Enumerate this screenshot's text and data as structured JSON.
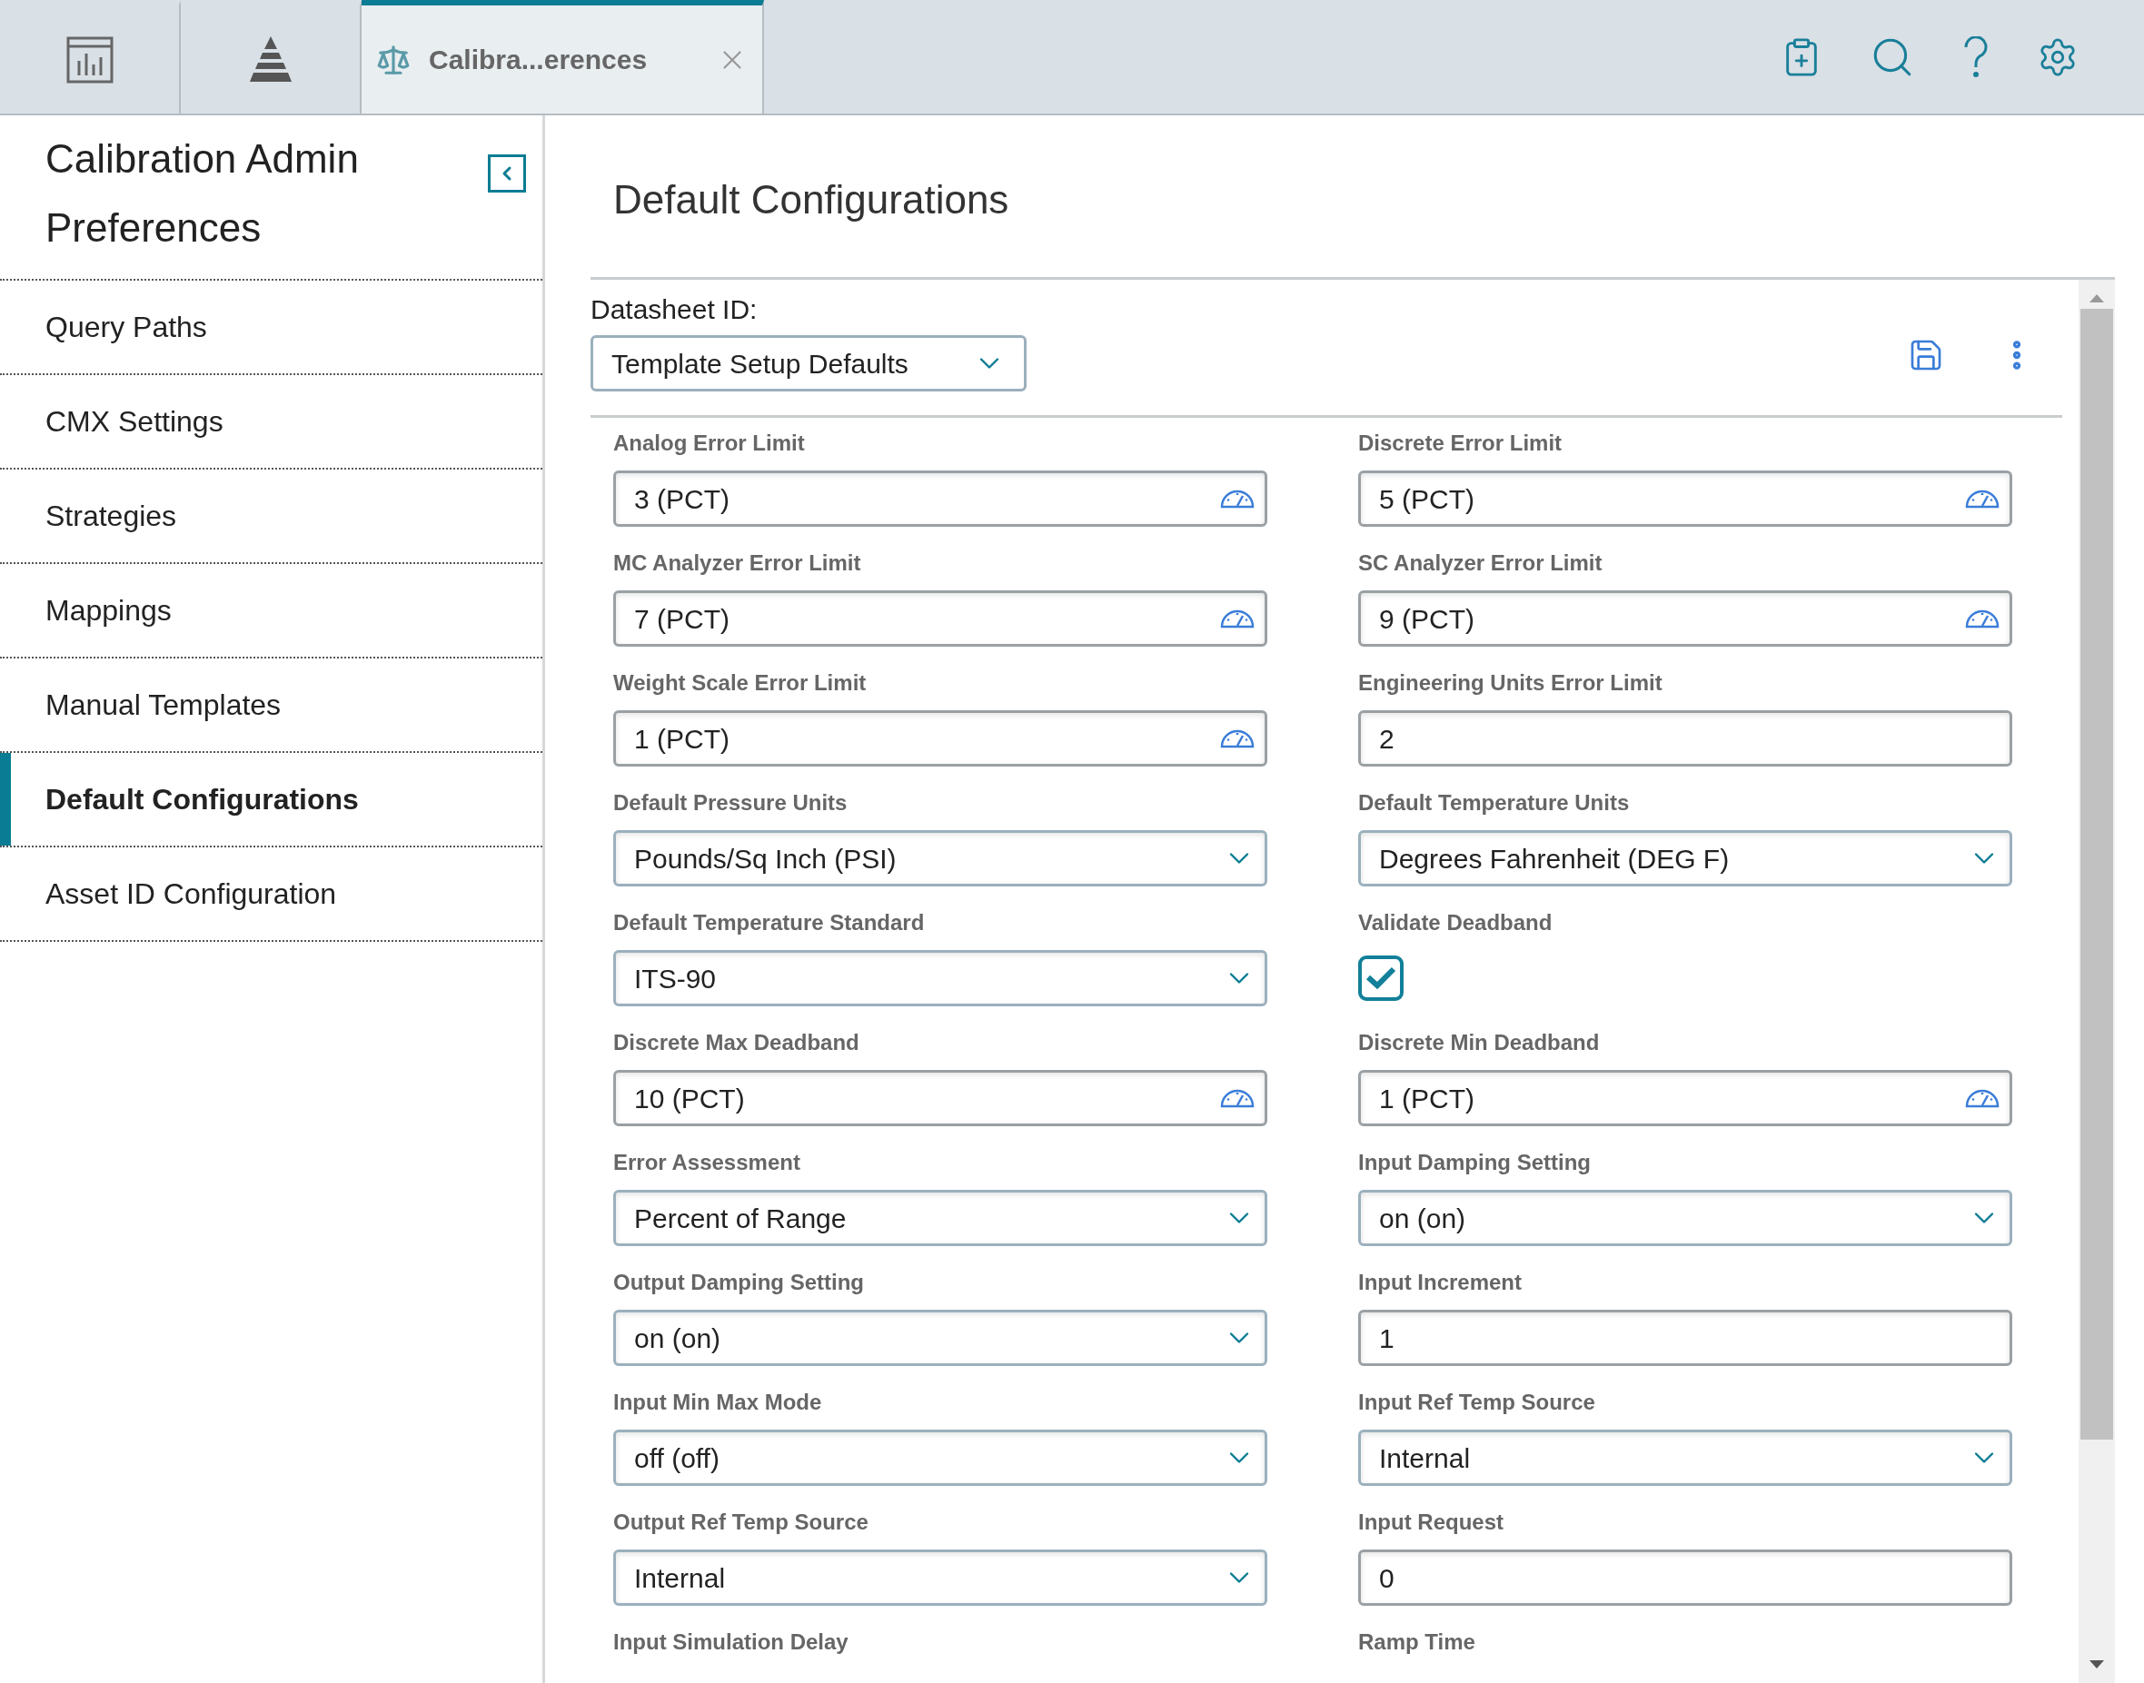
{
  "tabs": [
    {
      "kind": "chart",
      "selected": false
    },
    {
      "kind": "pyramid",
      "selected": false
    },
    {
      "kind": "document",
      "label": "Calibra...erences",
      "selected": true
    }
  ],
  "sidebar": {
    "title": "Calibration Admin Preferences",
    "items": [
      {
        "label": "Query Paths",
        "selected": false
      },
      {
        "label": "CMX Settings",
        "selected": false
      },
      {
        "label": "Strategies",
        "selected": false
      },
      {
        "label": "Mappings",
        "selected": false
      },
      {
        "label": "Manual Templates",
        "selected": false
      },
      {
        "label": "Default Configurations",
        "selected": true
      },
      {
        "label": "Asset ID Configuration",
        "selected": false
      }
    ]
  },
  "main": {
    "title": "Default Configurations",
    "datasheet": {
      "label": "Datasheet ID:",
      "value": "Template Setup Defaults"
    },
    "fields": [
      {
        "kind": "unit",
        "label": "Analog Error Limit",
        "value": "3 (PCT)"
      },
      {
        "kind": "unit",
        "label": "Discrete Error Limit",
        "value": "5 (PCT)"
      },
      {
        "kind": "unit",
        "label": "MC Analyzer Error Limit",
        "value": "7 (PCT)"
      },
      {
        "kind": "unit",
        "label": "SC Analyzer Error Limit",
        "value": "9 (PCT)"
      },
      {
        "kind": "unit",
        "label": "Weight Scale Error Limit",
        "value": "1 (PCT)"
      },
      {
        "kind": "text",
        "label": "Engineering Units Error Limit",
        "value": "2"
      },
      {
        "kind": "select",
        "label": "Default Pressure Units",
        "value": "Pounds/Sq Inch (PSI)"
      },
      {
        "kind": "select",
        "label": "Default Temperature Units",
        "value": "Degrees Fahrenheit (DEG F)"
      },
      {
        "kind": "select",
        "label": "Default Temperature Standard",
        "value": "ITS-90"
      },
      {
        "kind": "checkbox",
        "label": "Validate Deadband",
        "checked": true
      },
      {
        "kind": "unit",
        "label": "Discrete Max Deadband",
        "value": "10 (PCT)"
      },
      {
        "kind": "unit",
        "label": "Discrete Min Deadband",
        "value": "1 (PCT)"
      },
      {
        "kind": "select",
        "label": "Error Assessment",
        "value": "Percent of Range"
      },
      {
        "kind": "select",
        "label": "Input Damping Setting",
        "value": "on (on)"
      },
      {
        "kind": "select",
        "label": "Output Damping Setting",
        "value": "on (on)"
      },
      {
        "kind": "text",
        "label": "Input Increment",
        "value": "1"
      },
      {
        "kind": "select",
        "label": "Input Min Max Mode",
        "value": "off (off)"
      },
      {
        "kind": "select",
        "label": "Input Ref Temp Source",
        "value": "Internal"
      },
      {
        "kind": "select",
        "label": "Output Ref Temp Source",
        "value": "Internal"
      },
      {
        "kind": "text",
        "label": "Input Request",
        "value": "0"
      },
      {
        "kind": "label",
        "label": "Input Simulation Delay"
      },
      {
        "kind": "label",
        "label": "Ramp Time"
      }
    ]
  }
}
